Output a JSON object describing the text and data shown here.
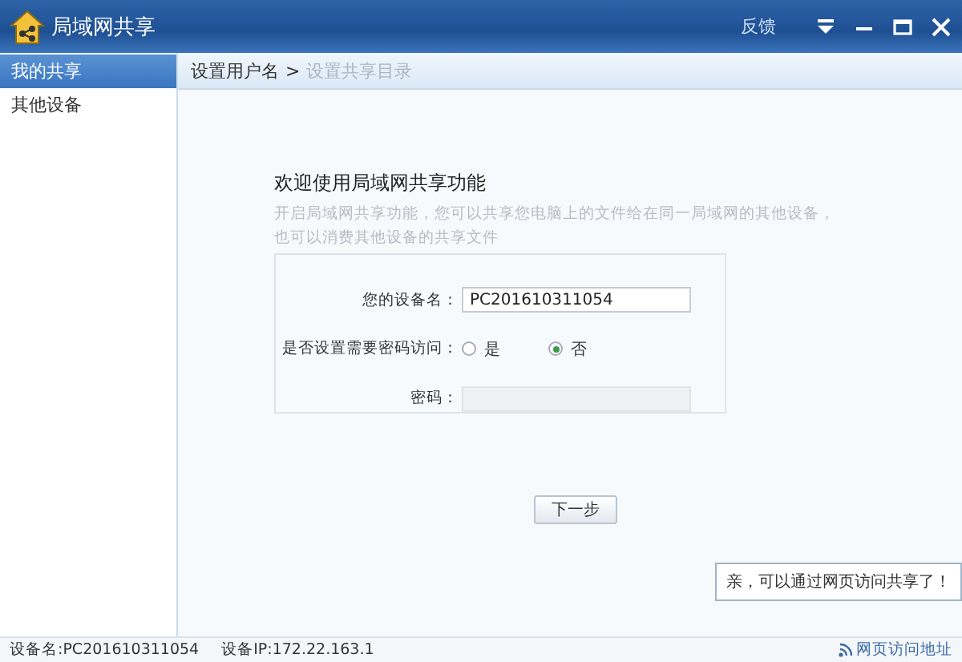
{
  "window": {
    "title": "局域网共享",
    "feedback": "反馈"
  },
  "sidebar": {
    "items": [
      {
        "label": "我的共享",
        "selected": true
      },
      {
        "label": "其他设备",
        "selected": false
      }
    ]
  },
  "breadcrumb": {
    "separator": ">",
    "steps": [
      {
        "label": "设置用户名",
        "active": true
      },
      {
        "label": "设置共享目录",
        "active": false
      }
    ]
  },
  "form": {
    "heading": "欢迎使用局域网共享功能",
    "description": [
      "开启局域网共享功能，您可以共享您电脑上的文件给在同一局域网的其他设备，",
      "也可以消费其他设备的共享文件"
    ],
    "device_name": {
      "label": "您的设备名：",
      "value": "PC201610311054"
    },
    "password_required": {
      "label": "是否设置需要密码访问：",
      "options": [
        {
          "label": "是",
          "selected": false
        },
        {
          "label": "否",
          "selected": true
        }
      ]
    },
    "password": {
      "label": "密码：",
      "disabled": true
    },
    "next_button": "下一步"
  },
  "tooltip": "亲，可以通过网页访问共享了！",
  "status_bar": {
    "device_name": "设备名:PC201610311054",
    "device_ip": "设备IP:172.22.163.1",
    "web_link": "网页访问地址"
  }
}
